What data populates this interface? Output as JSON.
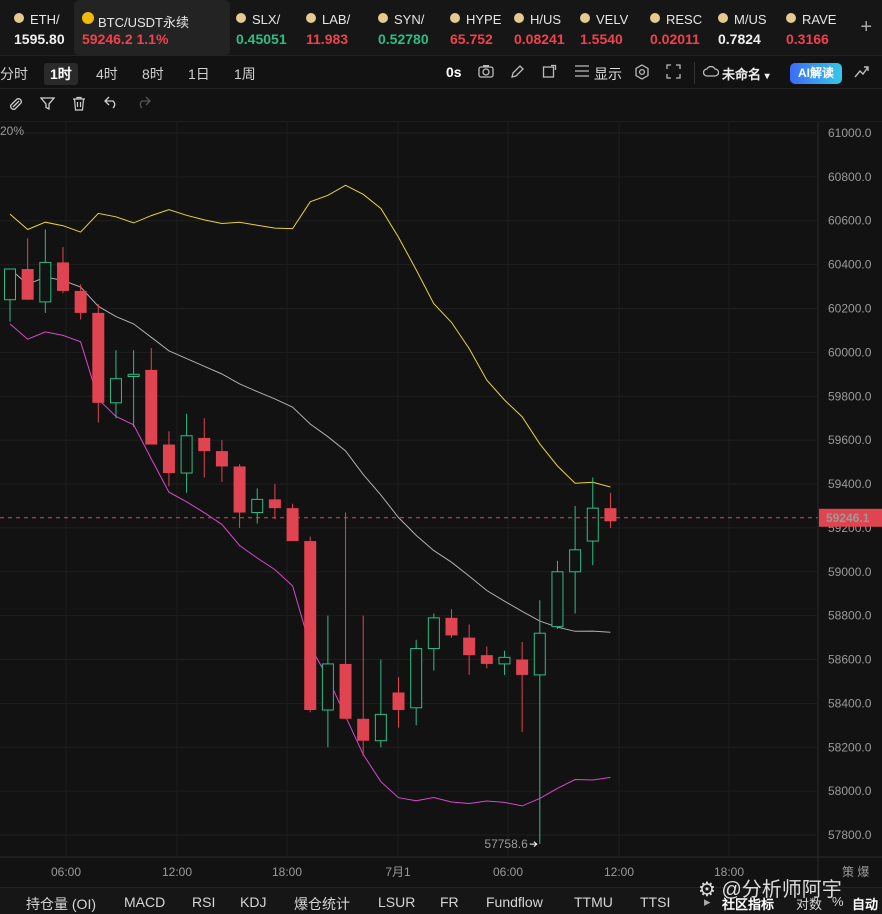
{
  "tickers": [
    {
      "symbol": "ETH/",
      "price": "1595.80",
      "state": "neutral"
    },
    {
      "symbol": "BTC/USDT永续",
      "price": "59246.2  1.1%",
      "state": "down",
      "active": true
    },
    {
      "symbol": "SLX/",
      "price": "0.45051",
      "state": "up"
    },
    {
      "symbol": "LAB/",
      "price": "11.983",
      "state": "down"
    },
    {
      "symbol": "SYN/",
      "price": "0.52780",
      "state": "up"
    },
    {
      "symbol": "HYPE",
      "price": "65.752",
      "state": "down"
    },
    {
      "symbol": "H/US",
      "price": "0.08241",
      "state": "down"
    },
    {
      "symbol": "VELV",
      "price": "1.5540",
      "state": "down"
    },
    {
      "symbol": "RESC",
      "price": "0.02011",
      "state": "down"
    },
    {
      "symbol": "M/US",
      "price": "0.7824",
      "state": "neutral"
    },
    {
      "symbol": "RAVE",
      "price": "0.3166",
      "state": "down"
    }
  ],
  "add_symbol": "+",
  "intervals": [
    "分时",
    "1时",
    "4时",
    "8时",
    "1日",
    "1周"
  ],
  "selected_interval": "1时",
  "toolbar": {
    "countdown": "0s",
    "display_label": "显示",
    "template_label": "未命名",
    "ai_label": "AI解读"
  },
  "chart_data": {
    "type": "candlestick",
    "overlay_label": "20%",
    "price_axis_ticks": [
      "61000.0",
      "60800.0",
      "60600.0",
      "60400.0",
      "60200.0",
      "60000.0",
      "59800.0",
      "59600.0",
      "59400.0",
      "59200.0",
      "59000.0",
      "58800.0",
      "58600.0",
      "58400.0",
      "58200.0",
      "58000.0",
      "57800.0"
    ],
    "time_axis_ticks": [
      "06:00",
      "12:00",
      "18:00",
      "7月1",
      "06:00",
      "12:00",
      "18:00"
    ],
    "time_axis_right": "策 爆",
    "current_price": "59246.1",
    "low_marker": "57758.6",
    "ylim": [
      57700,
      61050
    ],
    "candles": [
      {
        "o": 60240,
        "h": 60340,
        "l": 60140,
        "c": 60380
      },
      {
        "o": 60380,
        "h": 60520,
        "l": 60270,
        "c": 60240
      },
      {
        "o": 60230,
        "h": 60560,
        "l": 60180,
        "c": 60410
      },
      {
        "o": 60410,
        "h": 60480,
        "l": 60270,
        "c": 60280
      },
      {
        "o": 60280,
        "h": 60310,
        "l": 60150,
        "c": 60180
      },
      {
        "o": 60180,
        "h": 60220,
        "l": 59680,
        "c": 59770
      },
      {
        "o": 59770,
        "h": 60010,
        "l": 59700,
        "c": 59880
      },
      {
        "o": 59890,
        "h": 60010,
        "l": 59660,
        "c": 59900
      },
      {
        "o": 59920,
        "h": 60020,
        "l": 59660,
        "c": 59580
      },
      {
        "o": 59580,
        "h": 59640,
        "l": 59390,
        "c": 59450
      },
      {
        "o": 59450,
        "h": 59720,
        "l": 59360,
        "c": 59620
      },
      {
        "o": 59610,
        "h": 59700,
        "l": 59430,
        "c": 59550
      },
      {
        "o": 59550,
        "h": 59600,
        "l": 59410,
        "c": 59480
      },
      {
        "o": 59480,
        "h": 59490,
        "l": 59200,
        "c": 59270
      },
      {
        "o": 59270,
        "h": 59380,
        "l": 59220,
        "c": 59330
      },
      {
        "o": 59330,
        "h": 59400,
        "l": 59240,
        "c": 59290
      },
      {
        "o": 59290,
        "h": 59310,
        "l": 59150,
        "c": 59140
      },
      {
        "o": 59140,
        "h": 59160,
        "l": 58360,
        "c": 58370
      },
      {
        "o": 58370,
        "h": 58800,
        "l": 58200,
        "c": 58580
      },
      {
        "o": 58580,
        "h": 59270,
        "l": 58480,
        "c": 58330
      },
      {
        "o": 58330,
        "h": 58800,
        "l": 58160,
        "c": 58230
      },
      {
        "o": 58230,
        "h": 58600,
        "l": 58200,
        "c": 58350
      },
      {
        "o": 58450,
        "h": 58520,
        "l": 58290,
        "c": 58370
      },
      {
        "o": 58380,
        "h": 58690,
        "l": 58300,
        "c": 58650
      },
      {
        "o": 58650,
        "h": 58810,
        "l": 58550,
        "c": 58790
      },
      {
        "o": 58790,
        "h": 58830,
        "l": 58700,
        "c": 58710
      },
      {
        "o": 58700,
        "h": 58760,
        "l": 58530,
        "c": 58620
      },
      {
        "o": 58620,
        "h": 58660,
        "l": 58560,
        "c": 58580
      },
      {
        "o": 58580,
        "h": 58640,
        "l": 58530,
        "c": 58610
      },
      {
        "o": 58600,
        "h": 58680,
        "l": 58270,
        "c": 58530
      },
      {
        "o": 58530,
        "h": 58870,
        "l": 57760,
        "c": 58720
      },
      {
        "o": 58750,
        "h": 59050,
        "l": 58740,
        "c": 59000
      },
      {
        "o": 59000,
        "h": 59300,
        "l": 58810,
        "c": 59100
      },
      {
        "o": 59140,
        "h": 59430,
        "l": 59030,
        "c": 59290
      },
      {
        "o": 59290,
        "h": 59360,
        "l": 59200,
        "c": 59230
      }
    ],
    "colors": {
      "up": "#2ebd85",
      "down": "#e04450",
      "upper_band": "#e5d43a",
      "middle_band": "#d8d8d8",
      "lower_band": "#d948c8",
      "price_line": "#e04450"
    }
  },
  "indicators": [
    "持仓量 (OI)",
    "MACD",
    "RSI",
    "KDJ",
    "爆仓统计",
    "LSUR",
    "FR",
    "Fundflow",
    "TTMU",
    "TTSI"
  ],
  "indicator_bar_right": {
    "arrow": "▸",
    "community": "社区指标",
    "log": "对数",
    "percent": "%",
    "auto": "自动"
  },
  "watermark": "⚙ @分析师阿宇"
}
